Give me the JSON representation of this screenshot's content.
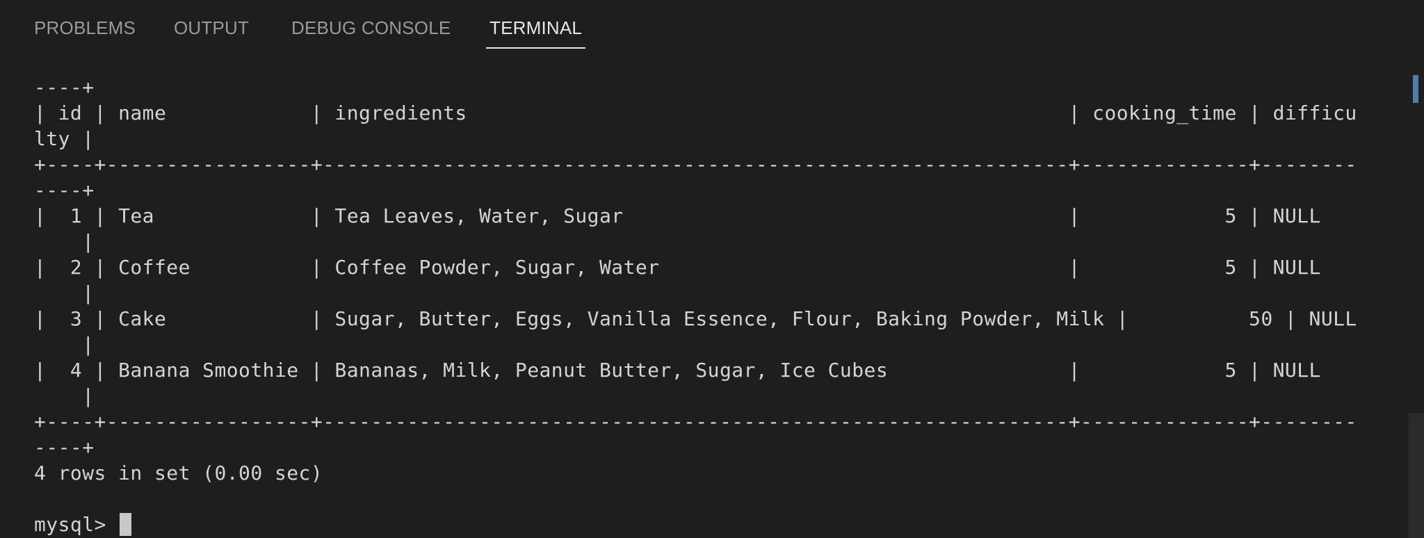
{
  "tabs": [
    {
      "label": "PROBLEMS"
    },
    {
      "label": "OUTPUT"
    },
    {
      "label": "DEBUG CONSOLE"
    },
    {
      "label": "TERMINAL"
    }
  ],
  "active_tab": "TERMINAL",
  "terminal": {
    "lines": [
      "----+",
      "| id | name            | ingredients                                                  | cooking_time | difficu",
      "lty |",
      "+----+-----------------+--------------------------------------------------------------+--------------+--------",
      "----+",
      "|  1 | Tea             | Tea Leaves, Water, Sugar                                     |            5 | NULL",
      "    |",
      "|  2 | Coffee          | Coffee Powder, Sugar, Water                                  |            5 | NULL",
      "    |",
      "|  3 | Cake            | Sugar, Butter, Eggs, Vanilla Essence, Flour, Baking Powder, Milk |          50 | NULL",
      "    |",
      "|  4 | Banana Smoothie | Bananas, Milk, Peanut Butter, Sugar, Ice Cubes               |            5 | NULL",
      "    |",
      "+----+-----------------+--------------------------------------------------------------+--------------+--------",
      "----+",
      "4 rows in set (0.00 sec)",
      ""
    ],
    "prompt": "mysql> "
  },
  "colors": {
    "background": "#1e1e1e",
    "text": "#d4d4d4",
    "tab_inactive": "#9a9a9a",
    "tab_active": "#e7e7e7",
    "scroll_marker": "#4f7ea8"
  }
}
